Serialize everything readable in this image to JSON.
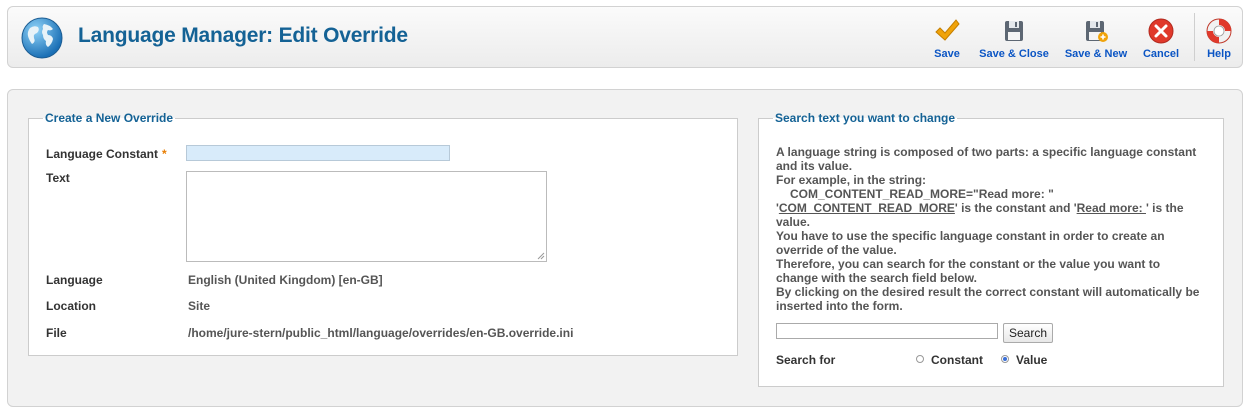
{
  "header": {
    "title": "Language Manager: Edit Override",
    "buttons": [
      {
        "label": "Save",
        "icon": "checkmark-icon"
      },
      {
        "label": "Save & Close",
        "icon": "floppy-disk-icon"
      },
      {
        "label": "Save & New",
        "icon": "floppy-disk-plus-icon"
      },
      {
        "label": "Cancel",
        "icon": "cancel-icon"
      },
      {
        "label": "Help",
        "icon": "lifebuoy-icon"
      }
    ]
  },
  "form": {
    "legend": "Create a New Override",
    "constant_label": "Language Constant",
    "required_mark": "*",
    "constant_value": "",
    "text_label": "Text",
    "text_value": "",
    "language_label": "Language",
    "language_value": "English (United Kingdom) [en-GB]",
    "location_label": "Location",
    "location_value": "Site",
    "file_label": "File",
    "file_value": "/home/jure-stern/public_html/language/overrides/en-GB.override.ini"
  },
  "search": {
    "legend": "Search text you want to change",
    "help1": "A language string is composed of two parts: a specific language constant and its value.",
    "help2": "For example, in the string:",
    "help3": "COM_CONTENT_READ_MORE=\"Read more: \"",
    "help4a": "'",
    "help4b": "COM_CONTENT_READ_MORE",
    "help4c": "' is the constant and '",
    "help4d": "Read more: ",
    "help4e": "' is the value.",
    "help5": "You have to use the specific language constant in order to create an override of the value.",
    "help6": "Therefore, you can search for the constant or the value you want to change with the search field below.",
    "help7": "By clicking on the desired result the correct constant will automatically be inserted into the form.",
    "input_value": "",
    "button_label": "Search",
    "search_for_label": "Search for",
    "options": [
      {
        "label": "Constant",
        "selected": false
      },
      {
        "label": "Value",
        "selected": true
      }
    ]
  },
  "colors": {
    "title": "#146295",
    "toolbar_label": "#0b55c4",
    "required": "#e87e04",
    "save_icon": "#f0a30a",
    "cancel_icon": "#e0392b"
  }
}
